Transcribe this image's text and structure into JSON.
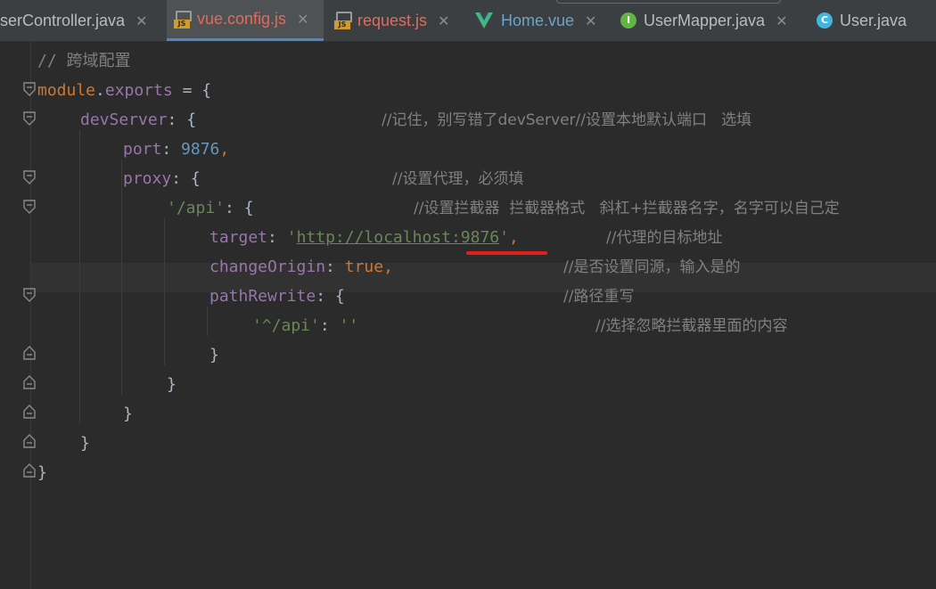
{
  "tabs": [
    {
      "label": "serController.java",
      "icon": "java-class-icon",
      "active": false
    },
    {
      "label": "vue.config.js",
      "icon": "js-file-icon",
      "active": true
    },
    {
      "label": "request.js",
      "icon": "js-file-icon",
      "active": false
    },
    {
      "label": "Home.vue",
      "icon": "vue-icon",
      "active": false
    },
    {
      "label": "UserMapper.java",
      "icon": "interface-icon",
      "active": false
    },
    {
      "label": "User.java",
      "icon": "class-icon",
      "active": false
    }
  ],
  "tab_icon_text": {
    "js": "JS",
    "interface": "I",
    "class": "C"
  },
  "colors": {
    "tab_active_text": "#e06c5c",
    "tab_text": "#bbbbbb",
    "editor_bg": "#2b2b2b",
    "keyword": "#cc7832",
    "string": "#6a8759",
    "number": "#6897bb",
    "property": "#9876aa",
    "comment": "#808080",
    "annotation_underline": "#e0201a"
  },
  "code": {
    "l1": "// 跨域配置",
    "l2": {
      "a": "module",
      "b": ".",
      "c": "exports",
      "d": " = {"
    },
    "l3": {
      "key": "devServer",
      "rest": ": {",
      "comment": "//记住，别写错了devServer//设置本地默认端口   选填"
    },
    "l4": {
      "key": "port",
      "colon": ": ",
      "value": "9876",
      "comma": ","
    },
    "l5": {
      "key": "proxy",
      "rest": ": {",
      "comment": "//设置代理，必须填"
    },
    "l6": {
      "key": "'/api'",
      "rest": ": {",
      "comment": "//设置拦截器  拦截器格式   斜杠+拦截器名字，名字可以自己定"
    },
    "l7": {
      "key": "target",
      "colon": ": ",
      "q1": "'",
      "url": "http://localhost:9876",
      "q2": "'",
      "comma": ",",
      "comment": "//代理的目标地址"
    },
    "l8": {
      "key": "changeOrigin",
      "colon": ": ",
      "value": "true",
      "comma": ",",
      "comment": "//是否设置同源，输入是的"
    },
    "l9": {
      "key": "pathRewrite",
      "rest": ": {",
      "comment": "//路径重写"
    },
    "l10": {
      "key": "'^/api'",
      "colon": ": ",
      "value": "''",
      "comment": "//选择忽略拦截器里面的内容"
    },
    "l11": "}",
    "l12": "}",
    "l13": "}",
    "l14": "}",
    "l15": "}"
  }
}
